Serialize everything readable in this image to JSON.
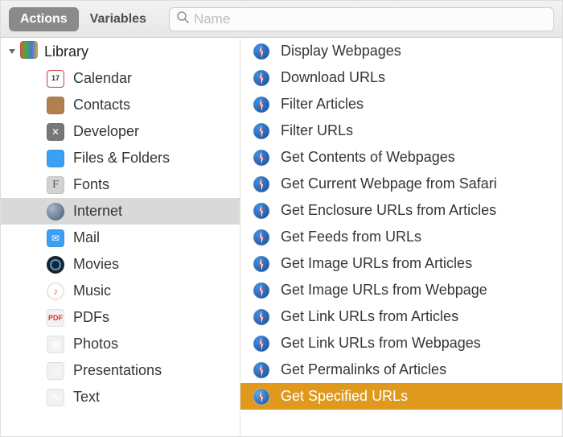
{
  "toolbar": {
    "tabs": {
      "actions": "Actions",
      "variables": "Variables",
      "active": "actions"
    },
    "search_placeholder": "Name",
    "search_value": ""
  },
  "sidebar": {
    "root_label": "Library",
    "root_expanded": true,
    "selected_index": 6,
    "items": [
      {
        "id": "calendar",
        "label": "Calendar",
        "icon": "calendar-icon"
      },
      {
        "id": "contacts",
        "label": "Contacts",
        "icon": "contacts-icon"
      },
      {
        "id": "developer",
        "label": "Developer",
        "icon": "developer-icon"
      },
      {
        "id": "files",
        "label": "Files & Folders",
        "icon": "finder-icon"
      },
      {
        "id": "fonts",
        "label": "Fonts",
        "icon": "fonts-icon"
      },
      {
        "id": "internet",
        "label": "Internet",
        "icon": "internet-icon"
      },
      {
        "id": "mail",
        "label": "Mail",
        "icon": "mail-icon"
      },
      {
        "id": "movies",
        "label": "Movies",
        "icon": "movies-icon"
      },
      {
        "id": "music",
        "label": "Music",
        "icon": "music-icon"
      },
      {
        "id": "pdfs",
        "label": "PDFs",
        "icon": "pdf-icon"
      },
      {
        "id": "photos",
        "label": "Photos",
        "icon": "photos-icon"
      },
      {
        "id": "presentations",
        "label": "Presentations",
        "icon": "presentations-icon"
      },
      {
        "id": "text",
        "label": "Text",
        "icon": "text-icon"
      }
    ]
  },
  "actions": {
    "selected_index": 14,
    "icon": "safari-icon",
    "items": [
      {
        "label": "Display Webpages"
      },
      {
        "label": "Download URLs"
      },
      {
        "label": "Filter Articles"
      },
      {
        "label": "Filter URLs"
      },
      {
        "label": "Get Contents of Webpages"
      },
      {
        "label": "Get Current Webpage from Safari"
      },
      {
        "label": "Get Enclosure URLs from Articles"
      },
      {
        "label": "Get Feeds from URLs"
      },
      {
        "label": "Get Image URLs from Articles"
      },
      {
        "label": "Get Image URLs from Webpage"
      },
      {
        "label": "Get Link URLs from Articles"
      },
      {
        "label": "Get Link URLs from Webpages"
      },
      {
        "label": "Get Permalinks of Articles"
      },
      {
        "label": "Get Specified URLs"
      }
    ]
  },
  "colors": {
    "selection_sidebar": "#d9d9d9",
    "selection_action": "#df9a1e"
  }
}
